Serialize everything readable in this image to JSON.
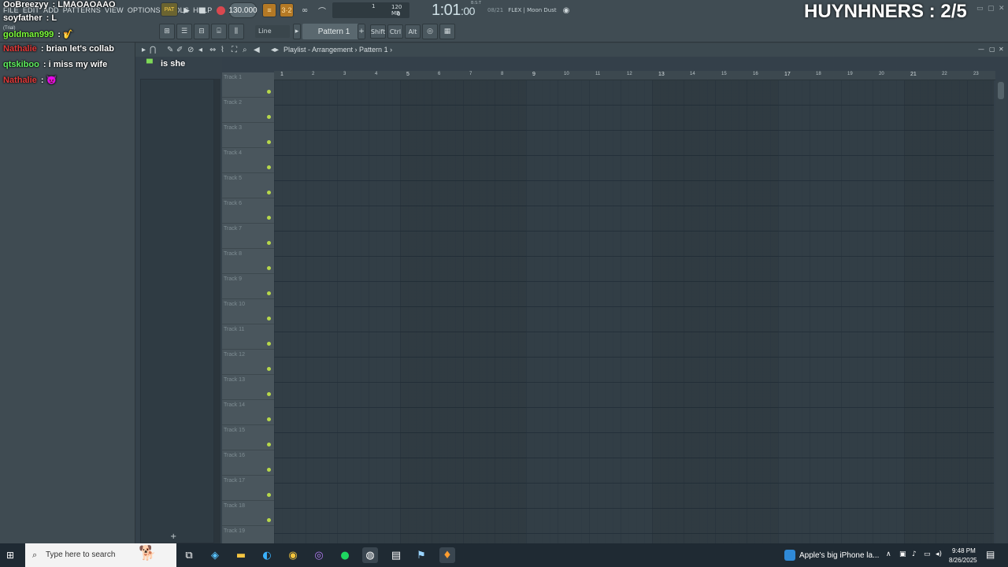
{
  "menu": [
    "FILE",
    "EDIT",
    "ADD",
    "PATTERNS",
    "VIEW",
    "OPTIONS",
    "TOOLS",
    "HELP"
  ],
  "transport": {
    "pat_label": "PAT",
    "tempo": "130.000",
    "cpu_value": "1",
    "memory": "120 MB",
    "memory_sub": "0",
    "time": "1:01",
    "time_ticks": ":00",
    "time_sub": "B:S:T",
    "hint_num": "08/21",
    "hint_text": "FLEX | Moon Dust"
  },
  "toolbar2": {
    "snap": "Line",
    "pattern": "Pattern 1",
    "keys": [
      "Shift",
      "Ctrl",
      "Alt"
    ]
  },
  "stream": {
    "title": "HUYNHNERS : 2/5"
  },
  "chat": [
    {
      "user": "OoBreezyy",
      "message": "LMAOAOAAO",
      "color": "#ffffff"
    },
    {
      "user": "soyfather",
      "message": "L",
      "color": "#ffffff"
    },
    {
      "user": "goldman999",
      "message": "🎷",
      "color": "#7cff3a"
    },
    {
      "user": "Nathalie",
      "message": "brian let's collab",
      "color": "#e23a3a"
    },
    {
      "user": "qtskiboo",
      "message": "i miss my wife",
      "color": "#5ef05e"
    },
    {
      "user": "Nathalie",
      "message": "😈",
      "color": "#e23a3a"
    }
  ],
  "chat_trial": "(Trial)",
  "chat_picker_msg": "is she",
  "playlist": {
    "title": "Playlist - Arrangement",
    "pattern": "Pattern 1",
    "tracks": [
      "Track 1",
      "Track 2",
      "Track 3",
      "Track 4",
      "Track 5",
      "Track 6",
      "Track 7",
      "Track 8",
      "Track 9",
      "Track 10",
      "Track 11",
      "Track 12",
      "Track 13",
      "Track 14",
      "Track 15",
      "Track 16",
      "Track 17",
      "Track 18",
      "Track 19"
    ],
    "bars": [
      "1",
      "2",
      "3",
      "4",
      "5",
      "6",
      "7",
      "8",
      "9",
      "10",
      "11",
      "12",
      "13",
      "14",
      "15",
      "16",
      "17",
      "18",
      "19",
      "20",
      "21",
      "22",
      "23"
    ]
  },
  "taskbar": {
    "search_placeholder": "Type here to search",
    "news": "Apple's big iPhone la...",
    "time": "9:48 PM",
    "date": "8/26/2025"
  }
}
